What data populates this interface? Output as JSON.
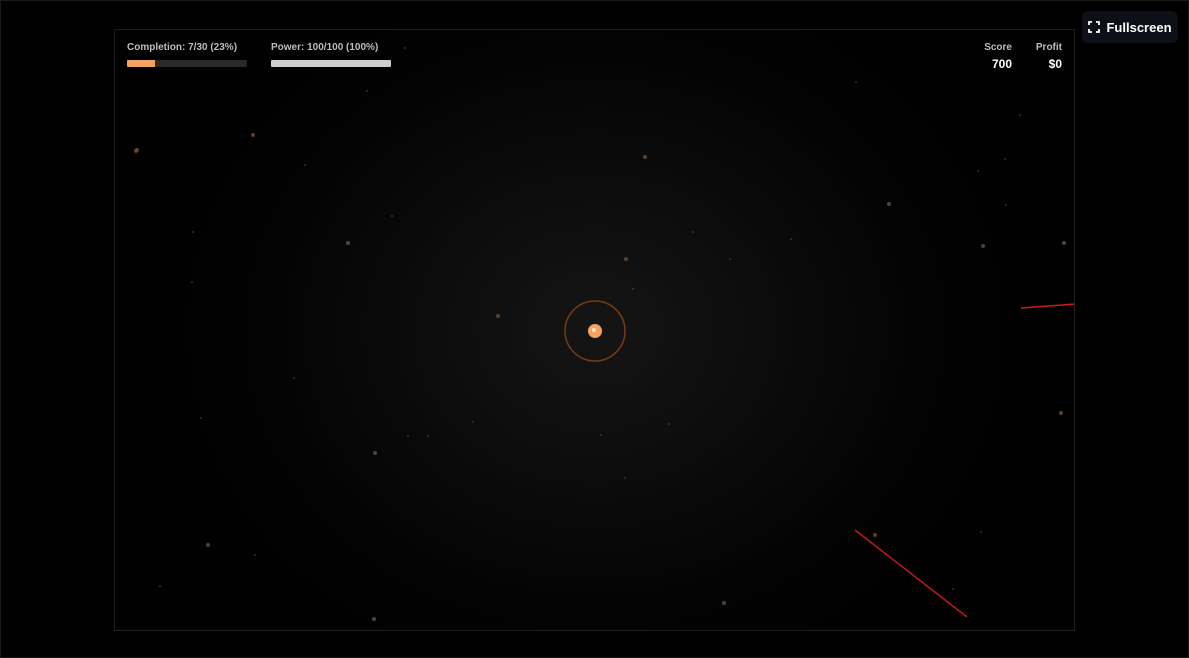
{
  "fullscreen": {
    "label": "Fullscreen",
    "icon": "expand-icon"
  },
  "hud": {
    "completion": {
      "label": "Completion: 7/30 (23%)",
      "current": 7,
      "total": 30,
      "fraction": 0.23,
      "color": "#f4a261"
    },
    "power": {
      "label": "Power: 100/100 (100%)",
      "current": 100,
      "total": 100,
      "fraction": 1.0,
      "color": "#cfcfcf"
    },
    "score": {
      "label": "Score",
      "value": "700"
    },
    "profit": {
      "label": "Profit",
      "value": "$0"
    }
  },
  "colors": {
    "accent": "#f4a261",
    "target_ring": "#b5541c",
    "laser": "#d01a1a",
    "particle": "#6b4a35"
  }
}
